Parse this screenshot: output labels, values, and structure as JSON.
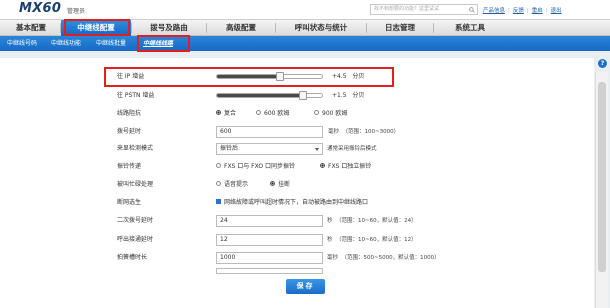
{
  "header": {
    "logo": "MX60",
    "user": "管理员",
    "search_placeholder": "找不到想要的功能？这里试试",
    "links": [
      "产品信息",
      "反馈",
      "重启",
      "退出"
    ]
  },
  "main_tabs": [
    {
      "label": "基本配置",
      "active": false
    },
    {
      "label": "中继线配置",
      "active": true
    },
    {
      "label": "拨号及路由",
      "active": false
    },
    {
      "label": "高级配置",
      "active": false
    },
    {
      "label": "呼叫状态与统计",
      "active": false
    },
    {
      "label": "日志管理",
      "active": false
    },
    {
      "label": "系统工具",
      "active": false
    }
  ],
  "sub_tabs": [
    {
      "label": "中继线号码",
      "active": false
    },
    {
      "label": "中继线功能",
      "active": false
    },
    {
      "label": "中继线批量",
      "active": false
    },
    {
      "label": "中继线线路",
      "active": true
    }
  ],
  "form": {
    "ip_gain": {
      "label": "往 IP 增益",
      "value": "+4.5",
      "unit": "分贝",
      "level": 0.6
    },
    "pstn_gain": {
      "label": "往 PSTN 增益",
      "value": "+1.5",
      "unit": "分贝",
      "level": 0.82
    },
    "impedance": {
      "label": "线路阻抗",
      "options": [
        "复合",
        "600 欧姆",
        "900 欧姆"
      ],
      "selected": 0
    },
    "dial_delay": {
      "label": "拨号延时",
      "value": "600",
      "unit": "毫秒",
      "hint": "（范围：100~3000）"
    },
    "caller_id_mode": {
      "label": "来显检测模式",
      "value": "振铃后",
      "hint": "通常采用振铃后模式"
    },
    "ring_mode": {
      "label": "振铃传递",
      "options": [
        "FXS 口与 FXO 口同步振铃",
        "FXS 口独立振铃"
      ],
      "selected": 1
    },
    "busy_handle": {
      "label": "被叫忙碌处理",
      "options": [
        "语音提示",
        "挂断"
      ],
      "selected": 1
    },
    "disconnect": {
      "label": "断网选生",
      "checkbox_text": "网络故障或呼叫超时情况下，自动被路由到中继线路口",
      "checked": true
    },
    "second_dial_delay": {
      "label": "二次拨号延时",
      "value": "24",
      "unit": "秒",
      "hint": "（范围：10~60，默认值：24）"
    },
    "call_connect_delay": {
      "label": "呼出接通延时",
      "value": "12",
      "unit": "秒",
      "hint": "（范围：10~60，默认值：12）"
    },
    "hook_flash": {
      "label": "拍簧槽时长",
      "value": "1000",
      "unit": "毫秒",
      "hint": "（范围：500~5000，默认值：1000）"
    }
  },
  "save_label": "保存",
  "colors": {
    "accent": "#1a6cc6",
    "highlight": "#e02020"
  },
  "icons": {
    "help": "help-icon",
    "search": "search-icon"
  }
}
